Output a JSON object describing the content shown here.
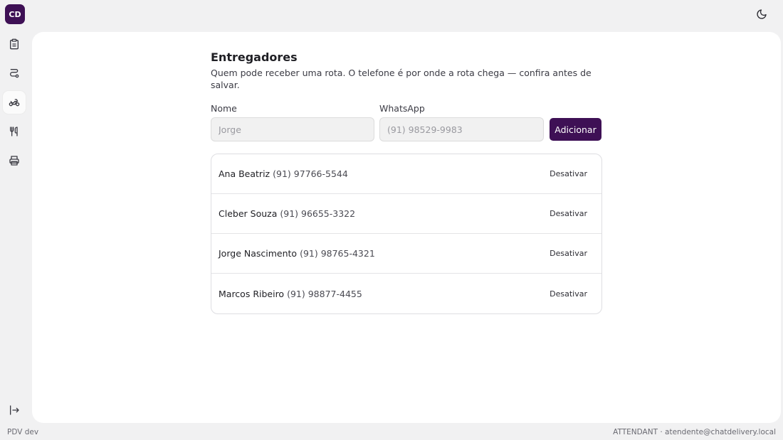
{
  "sidebar": {
    "logo": "CD",
    "items": [
      {
        "icon": "clipboard-icon"
      },
      {
        "icon": "route-icon"
      },
      {
        "icon": "motorcycle-icon",
        "active": true
      },
      {
        "icon": "utensils-icon"
      },
      {
        "icon": "printer-icon"
      }
    ],
    "logout_icon": "logout-icon"
  },
  "header": {
    "theme_icon": "moon-icon"
  },
  "page": {
    "title": "Entregadores",
    "description": "Quem pode receber uma rota. O telefone é por onde a rota chega — confira antes de salvar."
  },
  "form": {
    "name_label": "Nome",
    "name_placeholder": "Jorge",
    "whatsapp_label": "WhatsApp",
    "whatsapp_placeholder": "(91) 98529-9983",
    "add_label": "Adicionar"
  },
  "couriers": [
    {
      "name": "Ana Beatriz",
      "phone": "(91) 97766-5544",
      "action": "Desativar"
    },
    {
      "name": "Cleber Souza",
      "phone": "(91) 96655-3322",
      "action": "Desativar"
    },
    {
      "name": "Jorge Nascimento",
      "phone": "(91) 98765-4321",
      "action": "Desativar"
    },
    {
      "name": "Marcos Ribeiro",
      "phone": "(91) 98877-4455",
      "action": "Desativar"
    }
  ],
  "footer": {
    "env": "PDV dev",
    "user": "ATTENDANT · atendente@chatdelivery.local"
  },
  "colors": {
    "brand": "#3e1055",
    "background": "#f1f1f2"
  }
}
